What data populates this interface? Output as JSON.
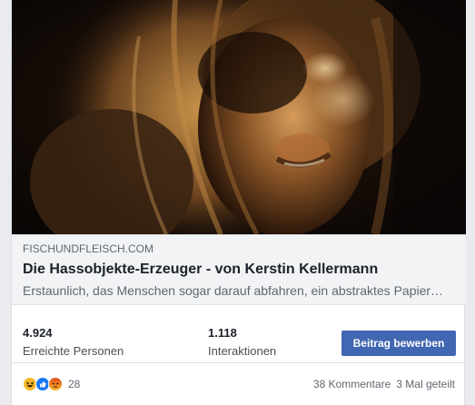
{
  "link_preview": {
    "domain": "FISCHUNDFLEISCH.COM",
    "title": "Die Hassobjekte-Erzeuger - von Kerstin Kellermann",
    "description": "Erstaunlich, das Menschen sogar darauf abfahren, ein abstraktes Papier…"
  },
  "insights": {
    "reach_value": "4.924",
    "reach_label": "Erreichte Personen",
    "engagement_value": "1.118",
    "engagement_label": "Interaktionen",
    "boost_label": "Beitrag bewerben"
  },
  "engagement": {
    "reaction_icons": [
      "haha-icon",
      "like-icon",
      "angry-icon"
    ],
    "reaction_count": "28",
    "comments": "38 Kommentare",
    "shares": "3 Mal geteilt"
  },
  "colors": {
    "accent": "#4267b2",
    "like": "#1877f2",
    "haha": "#f7b928",
    "angry": "#e9710f"
  }
}
